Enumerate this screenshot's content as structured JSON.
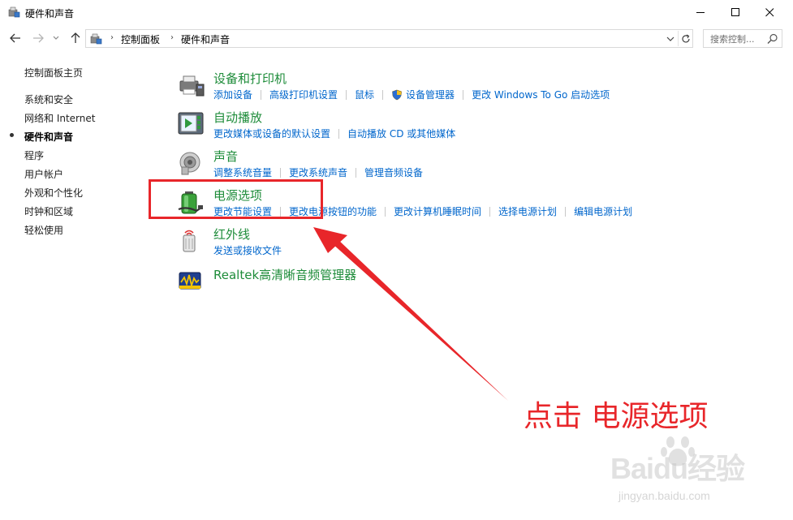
{
  "window": {
    "title": "硬件和声音"
  },
  "address": {
    "crumbs": [
      "控制面板",
      "硬件和声音"
    ],
    "separator": "›"
  },
  "search": {
    "placeholder": "搜索控制..."
  },
  "leftnav": {
    "home": "控制面板主页",
    "items": [
      "系统和安全",
      "网络和 Internet",
      "硬件和声音",
      "程序",
      "用户帐户",
      "外观和个性化",
      "时钟和区域",
      "轻松使用"
    ],
    "selected_index": 2
  },
  "categories": [
    {
      "title": "设备和打印机",
      "icon": "printer-icon",
      "links": [
        "添加设备",
        "高级打印机设置",
        "鼠标",
        "设备管理器",
        "更改 Windows To Go 启动选项"
      ]
    },
    {
      "title": "自动播放",
      "icon": "autoplay-icon",
      "links": [
        "更改媒体或设备的默认设置",
        "自动播放 CD 或其他媒体"
      ]
    },
    {
      "title": "声音",
      "icon": "speaker-icon",
      "links": [
        "调整系统音量",
        "更改系统声音",
        "管理音频设备"
      ]
    },
    {
      "title": "电源选项",
      "icon": "battery-icon",
      "links": [
        "更改节能设置",
        "更改电源按钮的功能",
        "更改计算机睡眠时间",
        "选择电源计划",
        "编辑电源计划"
      ]
    },
    {
      "title": "红外线",
      "icon": "infrared-icon",
      "links": [
        "发送或接收文件"
      ]
    },
    {
      "title": "Realtek高清晰音频管理器",
      "icon": "realtek-audio-icon",
      "links": []
    }
  ],
  "annotation": {
    "text": "点击 电源选项",
    "color": "#e8262a"
  },
  "watermark": {
    "brand": "Baidu经验",
    "url": "jingyan.baidu.com"
  },
  "colors": {
    "title_green": "#1e8c3a",
    "link_blue": "#0066cc"
  }
}
